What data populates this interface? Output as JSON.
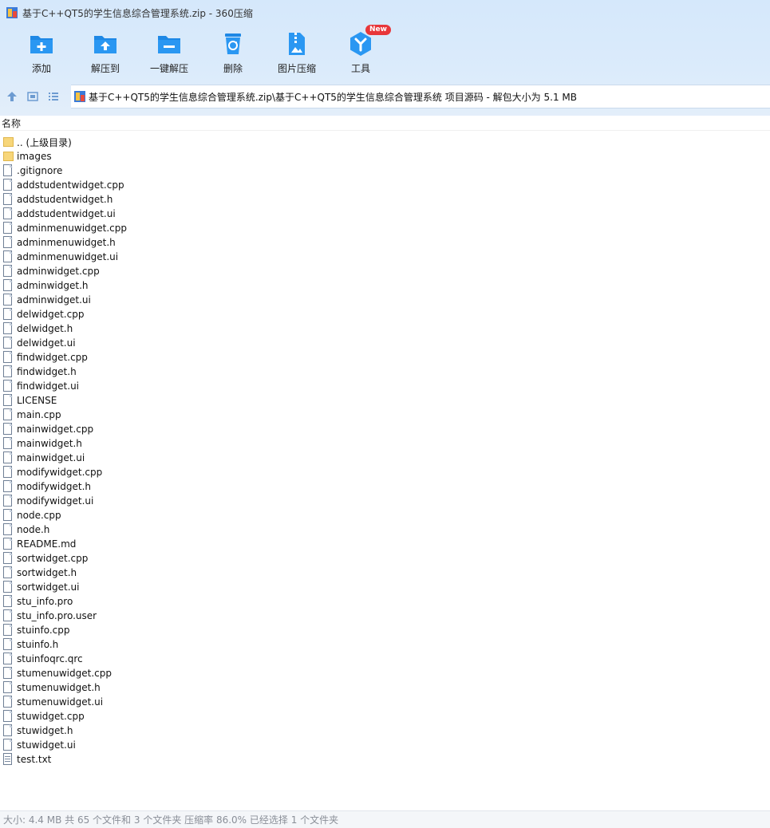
{
  "window": {
    "title": "基于C++QT5的学生信息综合管理系统.zip - 360压缩"
  },
  "toolbar": {
    "items": [
      {
        "label": "添加",
        "icon": "add-folder-icon"
      },
      {
        "label": "解压到",
        "icon": "extract-to-icon"
      },
      {
        "label": "一键解压",
        "icon": "one-click-extract-icon"
      },
      {
        "label": "删除",
        "icon": "recycle-delete-icon"
      },
      {
        "label": "图片压缩",
        "icon": "image-compress-icon"
      },
      {
        "label": "工具",
        "icon": "tools-icon",
        "badge": "New"
      }
    ]
  },
  "nav": {
    "path": "基于C++QT5的学生信息综合管理系统.zip\\基于C++QT5的学生信息综合管理系统 项目源码 - 解包大小为 5.1 MB"
  },
  "list_header": {
    "name_column": "名称"
  },
  "files": [
    {
      "name": ".. (上级目录)",
      "type": "folder"
    },
    {
      "name": "images",
      "type": "folder"
    },
    {
      "name": ".gitignore",
      "type": "file"
    },
    {
      "name": "addstudentwidget.cpp",
      "type": "file"
    },
    {
      "name": "addstudentwidget.h",
      "type": "file"
    },
    {
      "name": "addstudentwidget.ui",
      "type": "file"
    },
    {
      "name": "adminmenuwidget.cpp",
      "type": "file"
    },
    {
      "name": "adminmenuwidget.h",
      "type": "file"
    },
    {
      "name": "adminmenuwidget.ui",
      "type": "file"
    },
    {
      "name": "adminwidget.cpp",
      "type": "file"
    },
    {
      "name": "adminwidget.h",
      "type": "file"
    },
    {
      "name": "adminwidget.ui",
      "type": "file"
    },
    {
      "name": "delwidget.cpp",
      "type": "file"
    },
    {
      "name": "delwidget.h",
      "type": "file"
    },
    {
      "name": "delwidget.ui",
      "type": "file"
    },
    {
      "name": "findwidget.cpp",
      "type": "file"
    },
    {
      "name": "findwidget.h",
      "type": "file"
    },
    {
      "name": "findwidget.ui",
      "type": "file"
    },
    {
      "name": "LICENSE",
      "type": "file"
    },
    {
      "name": "main.cpp",
      "type": "file"
    },
    {
      "name": "mainwidget.cpp",
      "type": "file"
    },
    {
      "name": "mainwidget.h",
      "type": "file"
    },
    {
      "name": "mainwidget.ui",
      "type": "file"
    },
    {
      "name": "modifywidget.cpp",
      "type": "file"
    },
    {
      "name": "modifywidget.h",
      "type": "file"
    },
    {
      "name": "modifywidget.ui",
      "type": "file"
    },
    {
      "name": "node.cpp",
      "type": "file"
    },
    {
      "name": "node.h",
      "type": "file"
    },
    {
      "name": "README.md",
      "type": "file"
    },
    {
      "name": "sortwidget.cpp",
      "type": "file"
    },
    {
      "name": "sortwidget.h",
      "type": "file"
    },
    {
      "name": "sortwidget.ui",
      "type": "file"
    },
    {
      "name": "stu_info.pro",
      "type": "file"
    },
    {
      "name": "stu_info.pro.user",
      "type": "file"
    },
    {
      "name": "stuinfo.cpp",
      "type": "file"
    },
    {
      "name": "stuinfo.h",
      "type": "file"
    },
    {
      "name": "stuinfoqrc.qrc",
      "type": "file"
    },
    {
      "name": "stumenuwidget.cpp",
      "type": "file"
    },
    {
      "name": "stumenuwidget.h",
      "type": "file"
    },
    {
      "name": "stumenuwidget.ui",
      "type": "file"
    },
    {
      "name": "stuwidget.cpp",
      "type": "file"
    },
    {
      "name": "stuwidget.h",
      "type": "file"
    },
    {
      "name": "stuwidget.ui",
      "type": "file"
    },
    {
      "name": "test.txt",
      "type": "text"
    }
  ],
  "status": {
    "text": "大小: 4.4 MB 共 65 个文件和 3 个文件夹 压缩率 86.0% 已经选择 1 个文件夹"
  },
  "colors": {
    "accent": "#2a8cf0",
    "toolbar_bg": "#d8e9fb",
    "badge": "#e8373a"
  }
}
